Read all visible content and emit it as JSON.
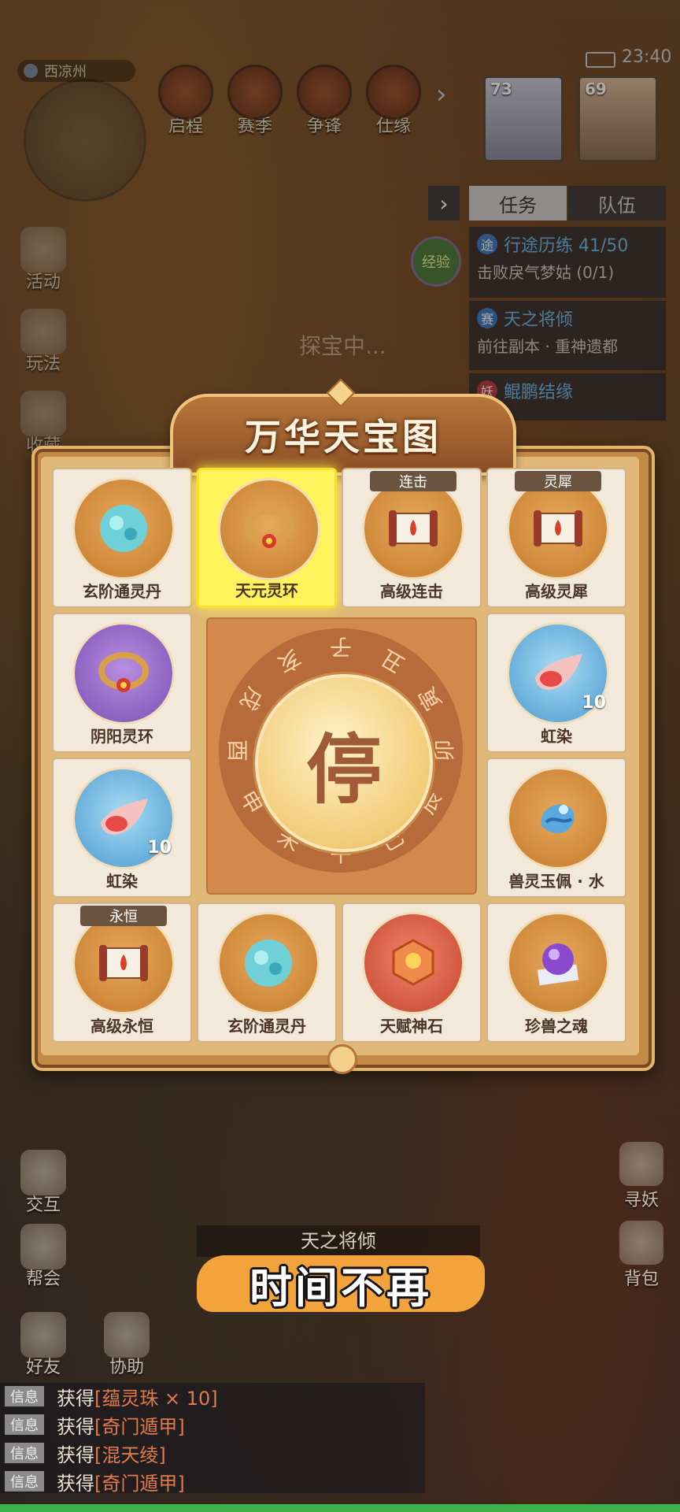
{
  "status": {
    "time": "23:40"
  },
  "map": {
    "location": "西凉州"
  },
  "top_menu": [
    {
      "label": "启程"
    },
    {
      "label": "赛季"
    },
    {
      "label": "争锋"
    },
    {
      "label": "仕缘"
    }
  ],
  "party": [
    {
      "level": "73"
    },
    {
      "level": "69"
    }
  ],
  "left_menu": [
    {
      "label": "活动"
    },
    {
      "label": "玩法"
    },
    {
      "label": "收藏"
    }
  ],
  "task_panel": {
    "tab_task": "任务",
    "tab_team": "队伍",
    "exp_label": "经验",
    "tasks": [
      {
        "tag": "途",
        "title": "行途历练 41/50",
        "detail": "击败戾气梦姑 (0/1)"
      },
      {
        "tag": "赛",
        "title": "天之将倾",
        "detail": "前往副本 · 重神遗都"
      },
      {
        "tag": "妖",
        "title": "鲲鹏结缘",
        "detail": ""
      }
    ]
  },
  "explore_status": "探宝中...",
  "board": {
    "title": "万华天宝图",
    "stop_label": "停",
    "wheel_chars": [
      "子",
      "丑",
      "寅",
      "卯",
      "辰",
      "巳",
      "午",
      "未",
      "申",
      "酉",
      "戌",
      "亥"
    ],
    "cells": [
      {
        "name": "玄阶通灵丹",
        "orb": "gold",
        "icon": "pill-icon",
        "badge": "",
        "qty": ""
      },
      {
        "name": "天元灵环",
        "orb": "gold",
        "icon": "ring-icon",
        "badge": "",
        "qty": ""
      },
      {
        "name": "高级连击",
        "orb": "gold",
        "icon": "scroll-icon",
        "badge": "连击",
        "qty": ""
      },
      {
        "name": "高级灵犀",
        "orb": "gold",
        "icon": "scroll-icon",
        "badge": "灵犀",
        "qty": ""
      },
      {
        "name": "阴阳灵环",
        "orb": "purple",
        "icon": "ring-icon",
        "badge": "",
        "qty": ""
      },
      {
        "name": "虹染",
        "orb": "blue",
        "icon": "dye-icon",
        "badge": "",
        "qty": "10"
      },
      {
        "name": "虹染",
        "orb": "blue",
        "icon": "dye-icon",
        "badge": "",
        "qty": "10"
      },
      {
        "name": "兽灵玉佩 · 水",
        "orb": "gold",
        "icon": "jade-icon",
        "badge": "",
        "qty": ""
      },
      {
        "name": "高级永恒",
        "orb": "gold",
        "icon": "scroll-icon",
        "badge": "永恒",
        "qty": ""
      },
      {
        "name": "玄阶通灵丹",
        "orb": "gold",
        "icon": "pill-icon",
        "badge": "",
        "qty": ""
      },
      {
        "name": "天赋神石",
        "orb": "red",
        "icon": "stone-icon",
        "badge": "",
        "qty": ""
      },
      {
        "name": "珍兽之魂",
        "orb": "gold",
        "icon": "soul-icon",
        "badge": "",
        "qty": ""
      }
    ]
  },
  "bottom_left_menu": [
    {
      "label": "交互"
    },
    {
      "label": "帮会"
    },
    {
      "label": "好友"
    },
    {
      "label": "协助"
    }
  ],
  "bottom_right_menu": [
    {
      "label": "寻妖"
    },
    {
      "label": "背包"
    }
  ],
  "quest_banner": "天之将倾",
  "subtitle": "时间不再",
  "chat": [
    {
      "channel": "信息",
      "prefix": "获得",
      "item": "[蕴灵珠 × 10]"
    },
    {
      "channel": "信息",
      "prefix": "获得",
      "item": "[奇门遁甲]"
    },
    {
      "channel": "信息",
      "prefix": "获得",
      "item": "[混天绫]"
    },
    {
      "channel": "信息",
      "prefix": "获得",
      "item": "[奇门遁甲]"
    }
  ]
}
